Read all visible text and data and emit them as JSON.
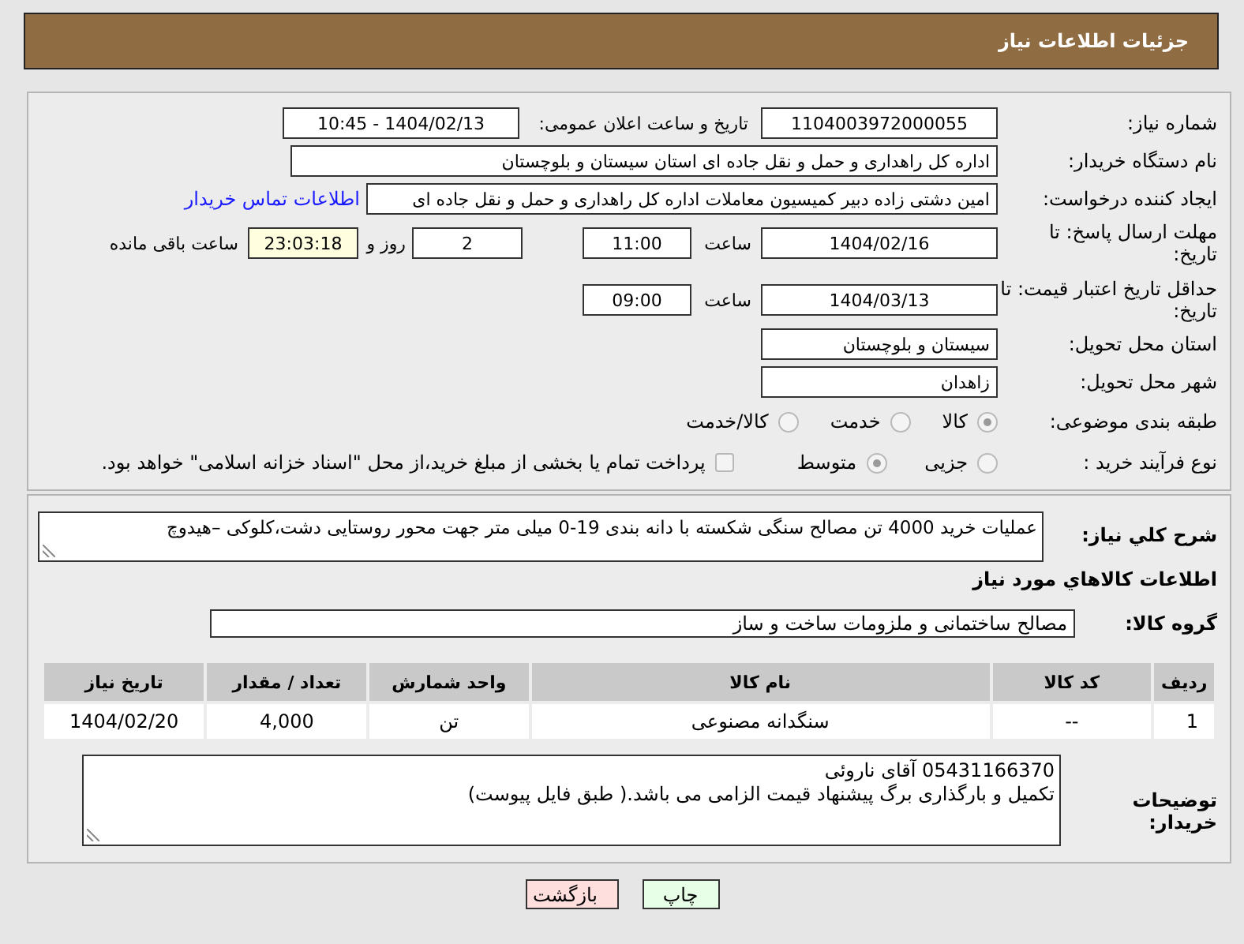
{
  "header": {
    "title": "جزئیات اطلاعات نیاز"
  },
  "details": {
    "need_number": {
      "label": "شماره نیاز:",
      "value": "1104003972000055"
    },
    "announce": {
      "label": "تاریخ و ساعت اعلان عمومی:",
      "value": "1404/02/13 - 10:45"
    },
    "buyer_org": {
      "label": "نام دستگاه خریدار:",
      "value": "اداره کل راهداری و حمل و نقل جاده ای استان سیستان و بلوچستان"
    },
    "requester": {
      "label": "ایجاد کننده درخواست:",
      "value": "امین دشتی زاده دبیر کمیسیون معاملات اداره کل راهداری و حمل و نقل جاده ای",
      "link": "اطلاعات تماس خریدار"
    },
    "deadline": {
      "label": "مهلت ارسال پاسخ: تا تاریخ:",
      "date": "1404/02/16",
      "time_label": "ساعت",
      "time": "11:00",
      "days": "2",
      "days_label": "روز و",
      "remaining": "23:03:18",
      "remaining_label": "ساعت باقی مانده"
    },
    "validity": {
      "label": "حداقل تاریخ اعتبار قیمت: تا تاریخ:",
      "date": "1404/03/13",
      "time_label": "ساعت",
      "time": "09:00"
    },
    "province": {
      "label": "استان محل تحویل:",
      "value": "سیستان و بلوچستان"
    },
    "city": {
      "label": "شهر محل تحویل:",
      "value": "زاهدان"
    },
    "category": {
      "label": "طبقه بندی موضوعی:",
      "options": [
        {
          "label": "کالا",
          "selected": true
        },
        {
          "label": "خدمت",
          "selected": false
        },
        {
          "label": "کالا/خدمت",
          "selected": false
        }
      ]
    },
    "process": {
      "label": "نوع فرآیند خرید :",
      "options": [
        {
          "label": "جزیی",
          "selected": false
        },
        {
          "label": "متوسط",
          "selected": true
        }
      ],
      "treasury": {
        "checked": false,
        "text": "پرداخت تمام یا بخشی از مبلغ خرید،از محل \"اسناد خزانه اسلامی\" خواهد بود."
      }
    }
  },
  "needs": {
    "summary": {
      "label": "شرح کلي نیاز:",
      "value": "عملیات خرید 4000 تن مصالح سنگی شکسته با دانه بندی 19-0 میلی متر جهت محور روستایی دشت،کلوکی –هیدوچ"
    },
    "goods_heading": "اطلاعات کالاهاي مورد نیاز",
    "group": {
      "label": "گروه کالا:",
      "value": "مصالح ساختمانی و ملزومات ساخت و ساز"
    },
    "table": {
      "columns": [
        "ردیف",
        "کد کالا",
        "نام کالا",
        "واحد شمارش",
        "تعداد / مقدار",
        "تاریخ نیاز"
      ],
      "rows": [
        [
          "1",
          "--",
          "سنگدانه مصنوعی",
          "تن",
          "4,000",
          "1404/02/20"
        ]
      ]
    },
    "notes": {
      "label": "توضیحات خریدار:",
      "lines": [
        "05431166370 آقای ناروئی",
        "تکمیل و بارگذاری برگ پیشنهاد قیمت الزامی می باشد.( طبق فایل پیوست)"
      ]
    }
  },
  "buttons": [
    {
      "kind": "print",
      "label": "چاپ"
    },
    {
      "kind": "back",
      "label": "بازگشت"
    }
  ]
}
